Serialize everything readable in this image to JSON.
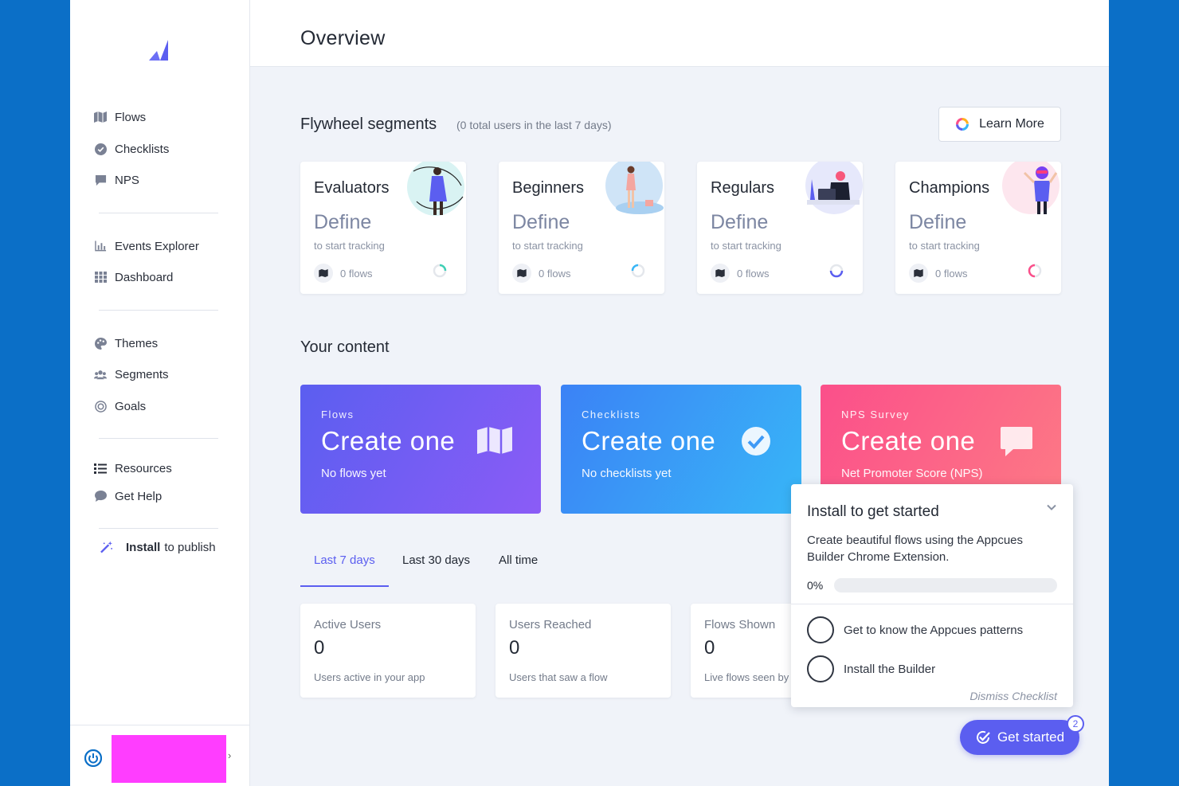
{
  "sidebar": {
    "nav": [
      {
        "label": "Flows",
        "icon": "map-icon"
      },
      {
        "label": "Checklists",
        "icon": "check-circle-icon"
      },
      {
        "label": "NPS",
        "icon": "chat-bubble-icon"
      },
      {
        "label": "Events Explorer",
        "icon": "bar-chart-icon"
      },
      {
        "label": "Dashboard",
        "icon": "grid-icon"
      },
      {
        "label": "Themes",
        "icon": "palette-icon"
      },
      {
        "label": "Segments",
        "icon": "users-icon"
      },
      {
        "label": "Goals",
        "icon": "target-icon"
      },
      {
        "label": "Resources",
        "icon": "list-icon"
      },
      {
        "label": "Get Help",
        "icon": "help-bubble-icon"
      }
    ],
    "install": {
      "bold": "Install",
      "rest": "to publish"
    }
  },
  "header": {
    "title": "Overview"
  },
  "flywheel": {
    "title": "Flywheel segments",
    "subtitle": "(0 total users in the last 7 days)",
    "learn_more": "Learn More",
    "segments": [
      {
        "name": "Evaluators",
        "define": "Define",
        "hint": "to start tracking",
        "flows": "0 flows"
      },
      {
        "name": "Beginners",
        "define": "Define",
        "hint": "to start tracking",
        "flows": "0 flows"
      },
      {
        "name": "Regulars",
        "define": "Define",
        "hint": "to start tracking",
        "flows": "0 flows"
      },
      {
        "name": "Champions",
        "define": "Define",
        "hint": "to start tracking",
        "flows": "0 flows"
      }
    ]
  },
  "content": {
    "title": "Your content",
    "cards": [
      {
        "label": "Flows",
        "title": "Create one",
        "sub": "No flows yet"
      },
      {
        "label": "Checklists",
        "title": "Create one",
        "sub": "No checklists yet"
      },
      {
        "label": "NPS Survey",
        "title": "Create one",
        "sub": "Net Promoter Score (NPS)"
      }
    ]
  },
  "tabs": [
    "Last 7 days",
    "Last 30 days",
    "All time"
  ],
  "stats": [
    {
      "label": "Active Users",
      "value": "0",
      "desc": "Users active in your app"
    },
    {
      "label": "Users Reached",
      "value": "0",
      "desc": "Users that saw a flow"
    },
    {
      "label": "Flows Shown",
      "value": "0",
      "desc": "Live flows seen by users"
    }
  ],
  "checklist": {
    "title": "Install to get started",
    "desc": "Create beautiful flows using the Appcues Builder Chrome Extension.",
    "progress_label": "0%",
    "progress": 0,
    "items": [
      "Get to know the Appcues patterns",
      "Install the Builder"
    ],
    "dismiss": "Dismiss Checklist"
  },
  "get_started": {
    "label": "Get started",
    "badge": "2"
  },
  "colors": {
    "accent": "#5b5ef0",
    "flows_gradient": [
      "#5b5ef0",
      "#8b5cf6"
    ],
    "checklists_gradient": [
      "#3b82f6",
      "#38b6f7"
    ],
    "nps_gradient": [
      "#fb4f8a",
      "#fd7a85"
    ]
  }
}
